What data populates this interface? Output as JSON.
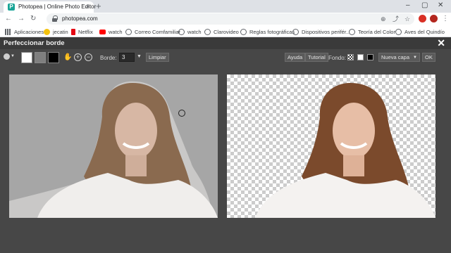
{
  "browser": {
    "tab_title": "Photopea | Online Photo Editor",
    "tab_favicon": "P",
    "close_tab": "×",
    "new_tab": "+",
    "url": "photopea.com",
    "win_min": "–",
    "win_max": "▢",
    "win_close": "✕"
  },
  "bookmarks": [
    {
      "label": "Aplicaciones",
      "icon": "apps-grid-icon",
      "color": "#5f6368"
    },
    {
      "label": "jecatin",
      "icon": "smiley-icon",
      "color": "#f4c20d"
    },
    {
      "label": "Netflix",
      "icon": "netflix-icon",
      "color": "#e50914"
    },
    {
      "label": "watch",
      "icon": "youtube-icon",
      "color": "#ff0000"
    },
    {
      "label": "Correo Comfamiliar",
      "icon": "globe-icon",
      "color": "#5f6368"
    },
    {
      "label": "watch",
      "icon": "globe-icon",
      "color": "#5f6368"
    },
    {
      "label": "Clarovideo",
      "icon": "globe-icon",
      "color": "#5f6368"
    },
    {
      "label": "Reglas fotográficas",
      "icon": "globe-icon",
      "color": "#5f6368"
    },
    {
      "label": "Dispositivos perifér...",
      "icon": "globe-icon",
      "color": "#5f6368"
    },
    {
      "label": "Teoría del Color",
      "icon": "globe-icon",
      "color": "#5f6368"
    },
    {
      "label": "Aves del Quindío",
      "icon": "globe-icon",
      "color": "#5f6368"
    }
  ],
  "dialog": {
    "title": "Perfeccionar borde",
    "close": "✕",
    "border_label": "Borde:",
    "border_value": "3",
    "clear_button": "Limpiar",
    "help_button": "Ayuda",
    "tutorial_button": "Tutorial",
    "background_label": "Fondo:",
    "output_select": "Nueva capa",
    "ok_button": "OK",
    "colors": {
      "swatch_white": "#ffffff",
      "swatch_gray": "#7f7f7f",
      "swatch_black": "#000000",
      "left_canvas_bg": "#a6a6a6"
    }
  }
}
